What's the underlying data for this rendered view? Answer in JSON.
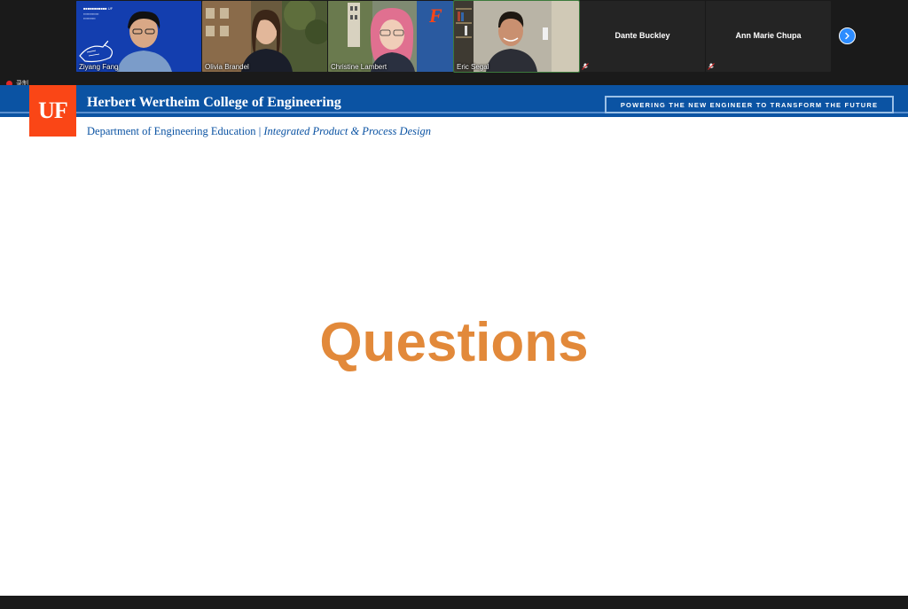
{
  "gallery": {
    "participants": [
      {
        "name": "Ziyang Fang",
        "video": true,
        "muted": false
      },
      {
        "name": "Olivia Brandel",
        "video": true,
        "muted": false
      },
      {
        "name": "Christine Lambert",
        "video": true,
        "muted": false
      },
      {
        "name": "Eric Segal",
        "video": true,
        "muted": false
      },
      {
        "name": "Dante Buckley",
        "video": false,
        "muted": true
      },
      {
        "name": "Ann Marie Chupa",
        "video": false,
        "muted": true
      }
    ],
    "next_icon": "chevron-right-icon"
  },
  "recording": {
    "label": "录制"
  },
  "slide": {
    "logo_text": "UF",
    "college": "Herbert Wertheim College of Engineering",
    "tagline": "POWERING THE NEW ENGINEER TO TRANSFORM THE FUTURE",
    "department": "Department of Engineering Education",
    "separator": " | ",
    "program": "Integrated Product & Process Design",
    "title": "Questions"
  },
  "colors": {
    "banner_blue": "#0b53a3",
    "uf_orange": "#fa4616",
    "title_orange": "#e2893a",
    "zoom_blue": "#2d8cff"
  }
}
